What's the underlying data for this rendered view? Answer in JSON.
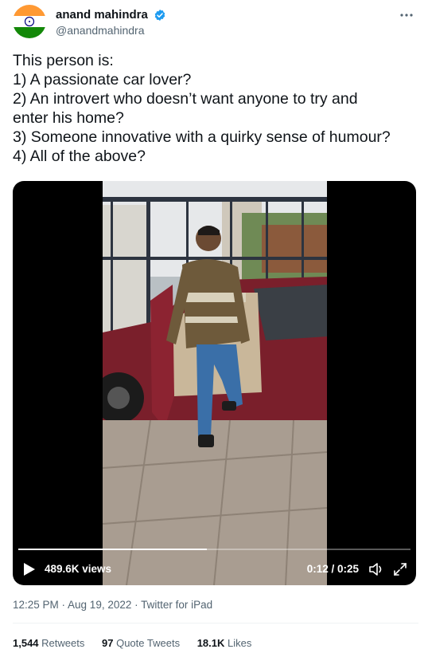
{
  "author": {
    "display_name": "anand mahindra",
    "handle": "@anandmahindra",
    "avatar": "india-flag-avatar",
    "verified_icon": "verified-badge-icon",
    "accent_color": "#1d9bf0"
  },
  "more_icon": "more-horizontal-icon",
  "tweet": {
    "lines": [
      "This person is:",
      "1) A passionate car lover?",
      "2) An introvert who doesn’t want anyone to try and",
      "enter his home?",
      "3) Someone innovative with a quirky sense of humour?",
      "4) All of the above?"
    ]
  },
  "video": {
    "views": "489.6K views",
    "time": "0:12 / 0:25",
    "progress": 0.48,
    "play_icon": "play-icon",
    "volume_icon": "volume-icon",
    "expand_icon": "fullscreen-icon"
  },
  "meta": {
    "text": "12:25 PM · Aug 19, 2022 · Twitter for iPad"
  },
  "stats": {
    "retweets_count": "1,544",
    "retweets_label": "Retweets",
    "quotes_count": "97",
    "quotes_label": "Quote Tweets",
    "likes_count": "18.1K",
    "likes_label": "Likes"
  }
}
